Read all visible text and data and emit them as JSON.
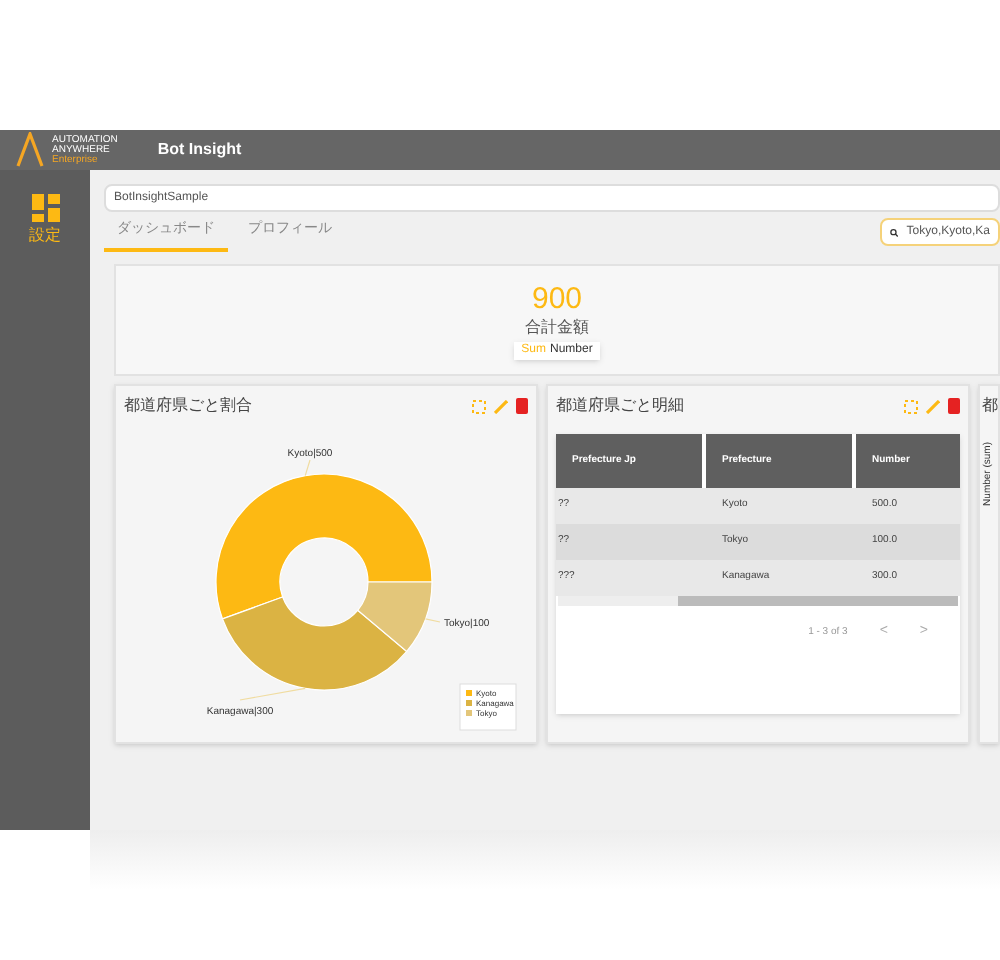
{
  "header": {
    "logo_lines": [
      "AUTOMATION",
      "ANYWHERE",
      "Enterprise"
    ],
    "title": "Bot Insight"
  },
  "sidebar": {
    "items": [
      {
        "label": "設定",
        "selected": true
      }
    ]
  },
  "dashboard_name": {
    "value": "BotInsightSample"
  },
  "tabs": [
    {
      "label": "ダッシュボード",
      "selected": true
    },
    {
      "label": "プロフィール",
      "selected": false
    }
  ],
  "filter": {
    "value": "Tokyo,Kyoto,Ka"
  },
  "summary": {
    "value": "900",
    "label": "合計金額",
    "badge_prefix": "Sum",
    "badge_field": "Number"
  },
  "pie_card": {
    "title": "都道府県ごと割合",
    "chart_data": {
      "type": "donut",
      "categories": [
        "Kyoto",
        "Kanagawa",
        "Tokyo"
      ],
      "values": [
        500,
        300,
        100
      ],
      "colors": [
        "#fdb913",
        "#dbb343",
        "#e3c67a"
      ],
      "legend": "bottom-right",
      "value_labels": [
        "Kyoto|500",
        "Kanagawa|300",
        "Tokyo|100"
      ]
    }
  },
  "table_card": {
    "title": "都道府県ごと明細",
    "columns": [
      "Prefecture Jp",
      "Prefecture",
      "Number"
    ],
    "rows": [
      [
        "??",
        "Kyoto",
        "500.0"
      ],
      [
        "??",
        "Tokyo",
        "100.0"
      ],
      [
        "???",
        "Kanagawa",
        "300.0"
      ]
    ],
    "pagination": "1 - 3 of 3",
    "prev": "<",
    "next": ">"
  },
  "third_card": {
    "title": "都",
    "axis_label": "Number (sum)"
  }
}
